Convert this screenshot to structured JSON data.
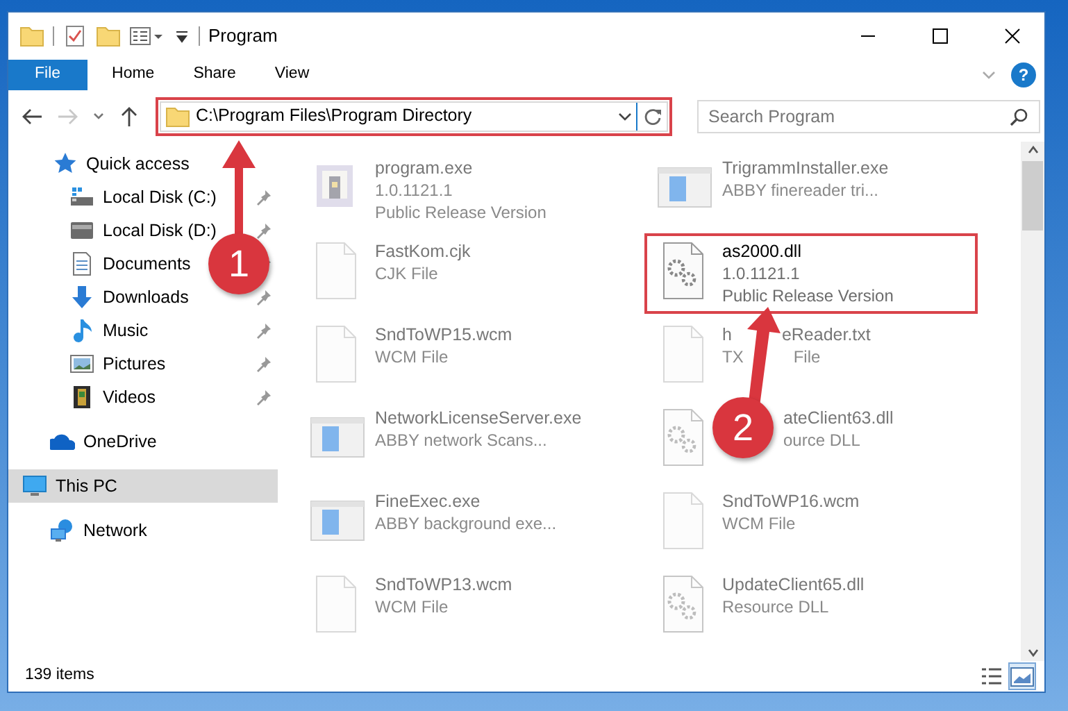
{
  "window": {
    "title": "Program"
  },
  "ribbon_tabs": [
    {
      "label": "File",
      "kind": "file",
      "selected": false
    },
    {
      "label": "Home",
      "kind": "tab",
      "selected": false
    },
    {
      "label": "Share",
      "kind": "tab",
      "selected": false
    },
    {
      "label": "View",
      "kind": "tab",
      "selected": false
    }
  ],
  "help_button": {
    "label": "?"
  },
  "navigation": {
    "forward_disabled": true
  },
  "address_bar": {
    "path": "C:\\Program Files\\Program Directory",
    "highlighted": true
  },
  "search": {
    "placeholder": "Search Program"
  },
  "sidebar": {
    "items": [
      {
        "label": "Quick access",
        "kind": "star",
        "selected": false,
        "children": [
          {
            "label": "Local Disk (C:)",
            "kind": "drive-windows",
            "pinned": true,
            "selected": false
          },
          {
            "label": "Local Disk (D:)",
            "kind": "drive",
            "pinned": true,
            "selected": false
          },
          {
            "label": "Documents",
            "kind": "documents",
            "pinned": true,
            "selected": false
          },
          {
            "label": "Downloads",
            "kind": "downloads",
            "pinned": true,
            "selected": false
          },
          {
            "label": "Music",
            "kind": "music",
            "pinned": true,
            "selected": false
          },
          {
            "label": "Pictures",
            "kind": "pictures",
            "pinned": true,
            "selected": false
          },
          {
            "label": "Videos",
            "kind": "videos",
            "pinned": true,
            "selected": false
          }
        ]
      },
      {
        "label": "OneDrive",
        "kind": "cloud",
        "selected": false
      },
      {
        "label": "This PC",
        "kind": "computer",
        "selected": true
      },
      {
        "label": "Network",
        "kind": "network",
        "selected": false
      }
    ]
  },
  "files": [
    {
      "name": "program.exe",
      "details": [
        "1.0.1121.1",
        "Public Release Version"
      ],
      "kind": "app",
      "highlighted": false
    },
    {
      "name": "TrigrammInstaller.exe",
      "details": [
        "ABBY finereader tri..."
      ],
      "kind": "window",
      "highlighted": false
    },
    {
      "name": "FastKom.cjk",
      "details": [
        "CJK File"
      ],
      "kind": "blank",
      "highlighted": false
    },
    {
      "name": "as2000.dll",
      "details": [
        "1.0.1121.1",
        "Public Release Version"
      ],
      "kind": "gear",
      "highlighted": true
    },
    {
      "name": "SndToWP15.wcm",
      "details": [
        "WCM File"
      ],
      "kind": "blank",
      "highlighted": false
    },
    {
      "name": [
        "h",
        "eReader.txt"
      ],
      "details": [
        [
          "TX",
          "File"
        ]
      ],
      "kind": "blank",
      "highlighted": false
    },
    {
      "name": "NetworkLicenseServer.exe",
      "details": [
        "ABBY network Scans..."
      ],
      "kind": "window",
      "highlighted": false
    },
    {
      "name": "ateClient63.dll",
      "details": [
        "ource DLL"
      ],
      "kind": "gear",
      "highlighted": false,
      "covered_start": true
    },
    {
      "name": "FineExec.exe",
      "details": [
        "ABBY background exe..."
      ],
      "kind": "window",
      "highlighted": false
    },
    {
      "name": "SndToWP16.wcm",
      "details": [
        "WCM File"
      ],
      "kind": "blank",
      "highlighted": false
    },
    {
      "name": "SndToWP13.wcm",
      "details": [
        "WCM File"
      ],
      "kind": "blank",
      "highlighted": false
    },
    {
      "name": "UpdateClient65.dll",
      "details": [
        "Resource DLL"
      ],
      "kind": "gear",
      "highlighted": false
    }
  ],
  "status_bar": {
    "item_count": "139 items"
  },
  "view_buttons": [
    {
      "kind": "details",
      "selected": false
    },
    {
      "kind": "large-icons",
      "selected": true
    }
  ],
  "annotations": [
    {
      "number": "1"
    },
    {
      "number": "2"
    }
  ]
}
